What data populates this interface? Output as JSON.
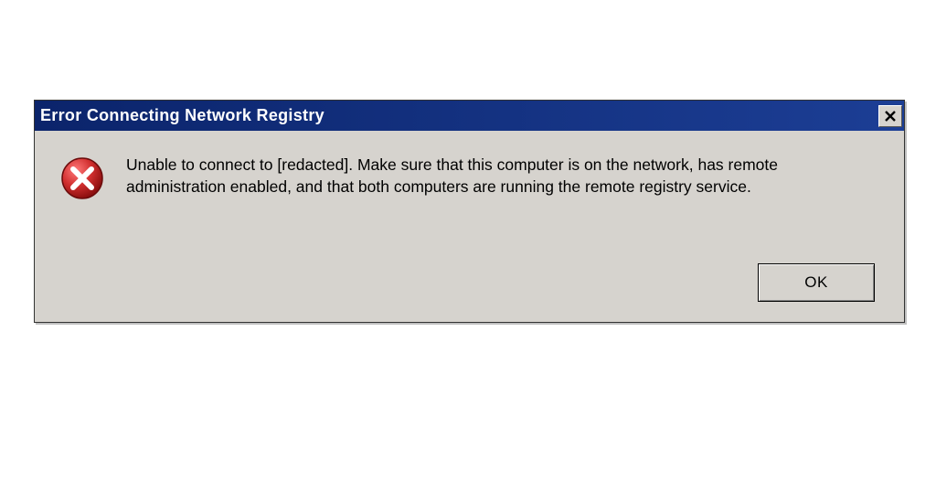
{
  "dialog": {
    "title": "Error Connecting Network Registry",
    "icon": "error-icon",
    "message": "Unable to connect to [redacted].  Make sure that this computer is on the network, has remote administration enabled, and that both computers are running the remote registry service.",
    "buttons": {
      "ok": "OK"
    },
    "colors": {
      "titlebar_start": "#0b246b",
      "titlebar_end": "#1c3e95",
      "face": "#d6d3ce",
      "error_red": "#d12f2f"
    }
  }
}
